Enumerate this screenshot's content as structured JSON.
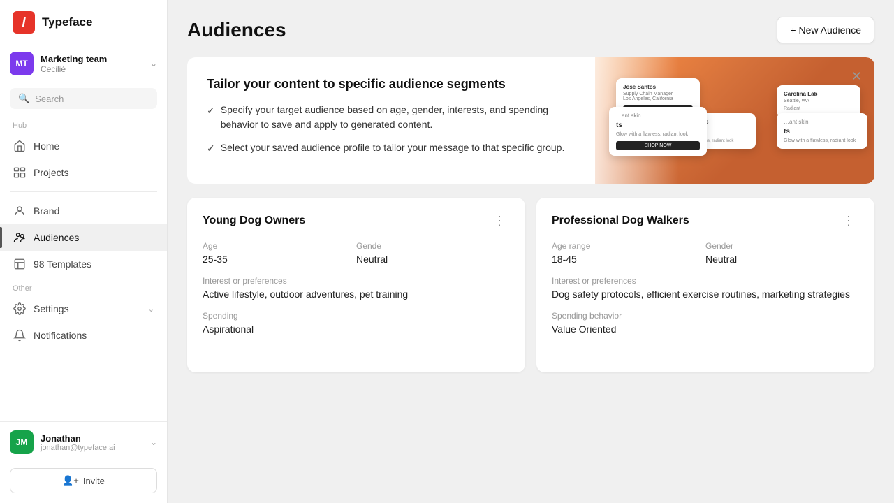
{
  "app": {
    "logo_letter": "I",
    "title": "Typeface"
  },
  "team": {
    "initials": "MT",
    "name": "Marketing team",
    "sub": "Cecilié"
  },
  "search": {
    "placeholder": "Search"
  },
  "nav": {
    "hub_label": "Hub",
    "other_label": "Other",
    "home": "Home",
    "projects": "Projects",
    "brand": "Brand",
    "audiences": "Audiences",
    "templates": "98 Templates",
    "settings": "Settings",
    "notifications": "Notifications"
  },
  "user": {
    "initials": "JM",
    "name": "Jonathan",
    "email": "jonathan@typeface.ai"
  },
  "invite_label": "Invite",
  "page": {
    "title": "Audiences",
    "new_button": "+ New Audience"
  },
  "banner": {
    "title": "Tailor your content to specific audience segments",
    "points": [
      "Specify your target audience based on age, gender, interests, and spending behavior to save and apply to generated content.",
      "Select your saved audience profile to tailor your message to that specific group."
    ]
  },
  "audiences": [
    {
      "title": "Young Dog Owners",
      "age_label": "Age",
      "age_value": "25-35",
      "gender_label": "Gende",
      "gender_value": "Neutral",
      "interest_label": "Interest or preferences",
      "interest_value": "Active lifestyle, outdoor adventures, pet training",
      "spending_label": "Spending",
      "spending_value": "Aspirational"
    },
    {
      "title": "Professional Dog Walkers",
      "age_label": "Age range",
      "age_value": "18-45",
      "gender_label": "Gender",
      "gender_value": "Neutral",
      "interest_label": "Interest or preferences",
      "interest_value": "Dog safety protocols, efficient exercise routines, marketing strategies",
      "spending_label": "Spending behavior",
      "spending_value": "Value Oriented"
    }
  ]
}
